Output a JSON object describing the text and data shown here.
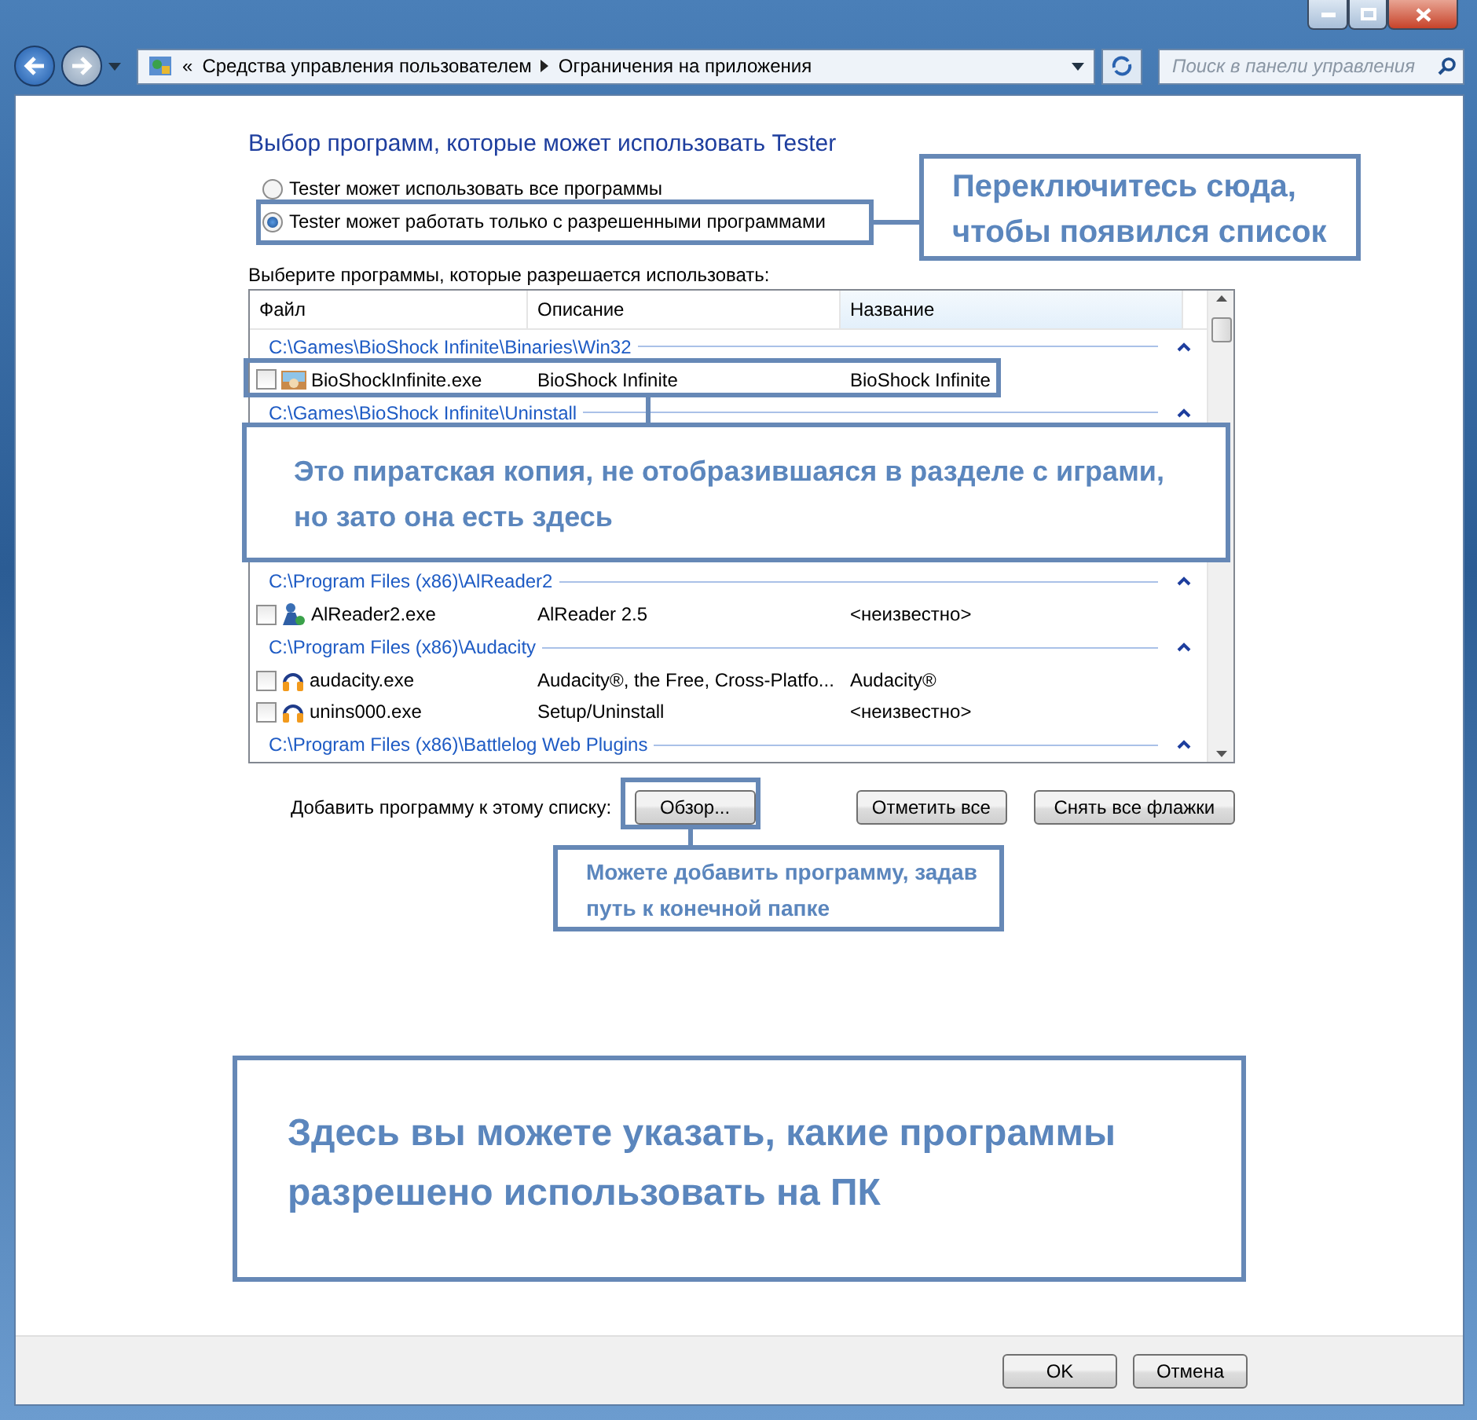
{
  "address_bar": {
    "overflow": "«",
    "crumbs": [
      "Средства управления пользователем",
      "Ограничения на приложения"
    ]
  },
  "search": {
    "placeholder": "Поиск в панели управления"
  },
  "heading": "Выбор программ, которые может использовать Tester",
  "radios": [
    {
      "label": "Tester может использовать все программы",
      "selected": false
    },
    {
      "label": "Tester может работать только с разрешенными программами",
      "selected": true
    }
  ],
  "list_label": "Выберите программы, которые разрешается использовать:",
  "columns": [
    "Файл",
    "Описание",
    "Название"
  ],
  "groups": [
    {
      "path": "C:\\Games\\BioShock Infinite\\Binaries\\Win32",
      "expanded": true,
      "items": [
        {
          "file": "BioShockInfinite.exe",
          "description": "BioShock Infinite",
          "name": "BioShock Infinite",
          "checked": false,
          "kind": "image"
        }
      ]
    },
    {
      "path": "C:\\Games\\BioShock Infinite\\Uninstall",
      "expanded": true
    },
    {
      "path": "C:\\Program Files (x86)\\AlReader2",
      "expanded": true,
      "items": [
        {
          "file": "AlReader2.exe",
          "description": "AlReader 2.5",
          "name": "<неизвестно>",
          "checked": false,
          "kind": "figure"
        }
      ]
    },
    {
      "path": "C:\\Program Files (x86)\\Audacity",
      "expanded": true,
      "items": [
        {
          "file": "audacity.exe",
          "description": "Audacity®, the Free, Cross-Platfo...",
          "name": "Audacity®",
          "checked": false,
          "kind": "headphones"
        },
        {
          "file": "unins000.exe",
          "description": "Setup/Uninstall",
          "name": "<неизвестно>",
          "checked": false,
          "kind": "headphones"
        }
      ]
    },
    {
      "path": "C:\\Program Files (x86)\\Battlelog Web Plugins",
      "expanded": true
    }
  ],
  "add_label": "Добавить программу к этому списку:",
  "buttons": {
    "browse": "Обзор...",
    "check_all": "Отметить все",
    "uncheck_all": "Снять все флажки"
  },
  "callouts": [
    "Переключитесь сюда, чтобы появился список",
    "Это пиратская копия, не отобразившаяся в разделе с играми, но зато она есть здесь",
    "Можете добавить программу, задав путь к конечной папке",
    "Здесь вы можете указать, какие программы разрешено использовать на ПК"
  ],
  "dialog_buttons": [
    "OK",
    "Отмена"
  ]
}
